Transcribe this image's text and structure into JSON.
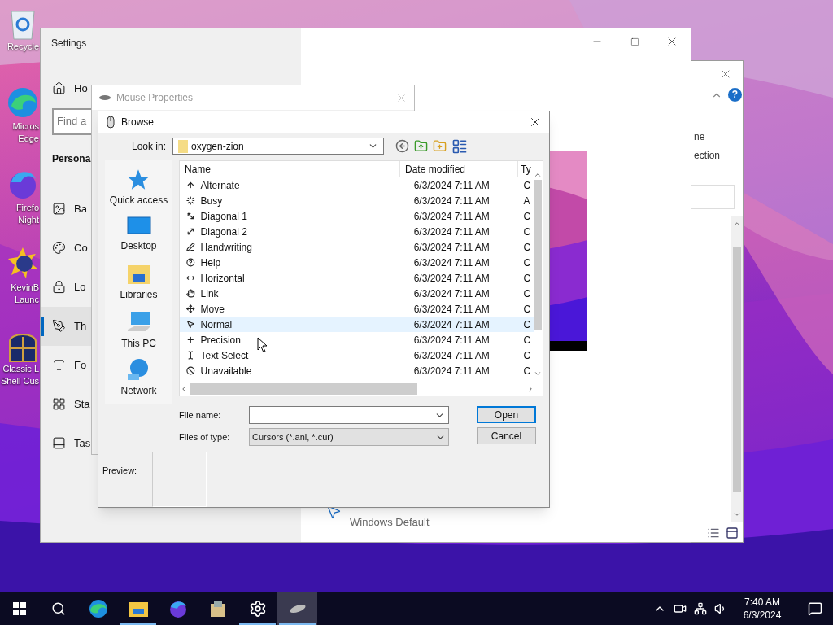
{
  "desktop_icons": [
    {
      "lines": [
        "Recycle"
      ]
    },
    {
      "lines": [
        "Micros",
        "Edge"
      ]
    },
    {
      "lines": [
        "Firefo",
        "Night"
      ]
    },
    {
      "lines": [
        "KevinB",
        "Launc"
      ]
    },
    {
      "lines": [
        "Classic L",
        "Shell Cus"
      ]
    }
  ],
  "back_window": {
    "help": "?",
    "texts": [
      "ne",
      "ection"
    ]
  },
  "settings": {
    "title": "Settings",
    "home": "Ho",
    "search_placeholder": "Find a",
    "section": "Persona",
    "cursor_value": "Windows Default",
    "nav": [
      {
        "label": "Ba",
        "selected": false
      },
      {
        "label": "Co",
        "selected": false
      },
      {
        "label": "Lo",
        "selected": false
      },
      {
        "label": "Th",
        "selected": true
      },
      {
        "label": "Fo",
        "selected": false
      },
      {
        "label": "Sta",
        "selected": false
      },
      {
        "label": "Tas",
        "selected": false
      }
    ]
  },
  "mouse_properties": {
    "title": "Mouse Properties"
  },
  "browse": {
    "title": "Browse",
    "look_in_label": "Look in:",
    "look_in": "oxygen-zion",
    "places": [
      "Quick access",
      "Desktop",
      "Libraries",
      "This PC",
      "Network"
    ],
    "columns": [
      "Name",
      "Date modified",
      "Ty"
    ],
    "files": [
      {
        "name": "Alternate",
        "date": "6/3/2024 7:11 AM",
        "type": "C",
        "selected": false
      },
      {
        "name": "Busy",
        "date": "6/3/2024 7:11 AM",
        "type": "A",
        "selected": false
      },
      {
        "name": "Diagonal 1",
        "date": "6/3/2024 7:11 AM",
        "type": "C",
        "selected": false
      },
      {
        "name": "Diagonal 2",
        "date": "6/3/2024 7:11 AM",
        "type": "C",
        "selected": false
      },
      {
        "name": "Handwriting",
        "date": "6/3/2024 7:11 AM",
        "type": "C",
        "selected": false
      },
      {
        "name": "Help",
        "date": "6/3/2024 7:11 AM",
        "type": "C",
        "selected": false
      },
      {
        "name": "Horizontal",
        "date": "6/3/2024 7:11 AM",
        "type": "C",
        "selected": false
      },
      {
        "name": "Link",
        "date": "6/3/2024 7:11 AM",
        "type": "C",
        "selected": false
      },
      {
        "name": "Move",
        "date": "6/3/2024 7:11 AM",
        "type": "C",
        "selected": false
      },
      {
        "name": "Normal",
        "date": "6/3/2024 7:11 AM",
        "type": "C",
        "selected": true
      },
      {
        "name": "Precision",
        "date": "6/3/2024 7:11 AM",
        "type": "C",
        "selected": false
      },
      {
        "name": "Text Select",
        "date": "6/3/2024 7:11 AM",
        "type": "C",
        "selected": false
      },
      {
        "name": "Unavailable",
        "date": "6/3/2024 7:11 AM",
        "type": "C",
        "selected": false
      }
    ],
    "file_name_label": "File name:",
    "file_type_label": "Files of type:",
    "file_type": "Cursors (*.ani, *.cur)",
    "buttons": [
      {
        "label": "Open",
        "default": true
      },
      {
        "label": "Cancel",
        "default": false
      }
    ],
    "preview_label": "Preview:"
  },
  "taskbar": {
    "time": "7:40 AM",
    "date": "6/3/2024",
    "apps": [
      {
        "running": false,
        "active": false
      },
      {
        "running": true,
        "active": false
      },
      {
        "running": false,
        "active": false
      },
      {
        "running": false,
        "active": false
      },
      {
        "running": true,
        "active": false
      },
      {
        "running": true,
        "active": true
      }
    ]
  }
}
